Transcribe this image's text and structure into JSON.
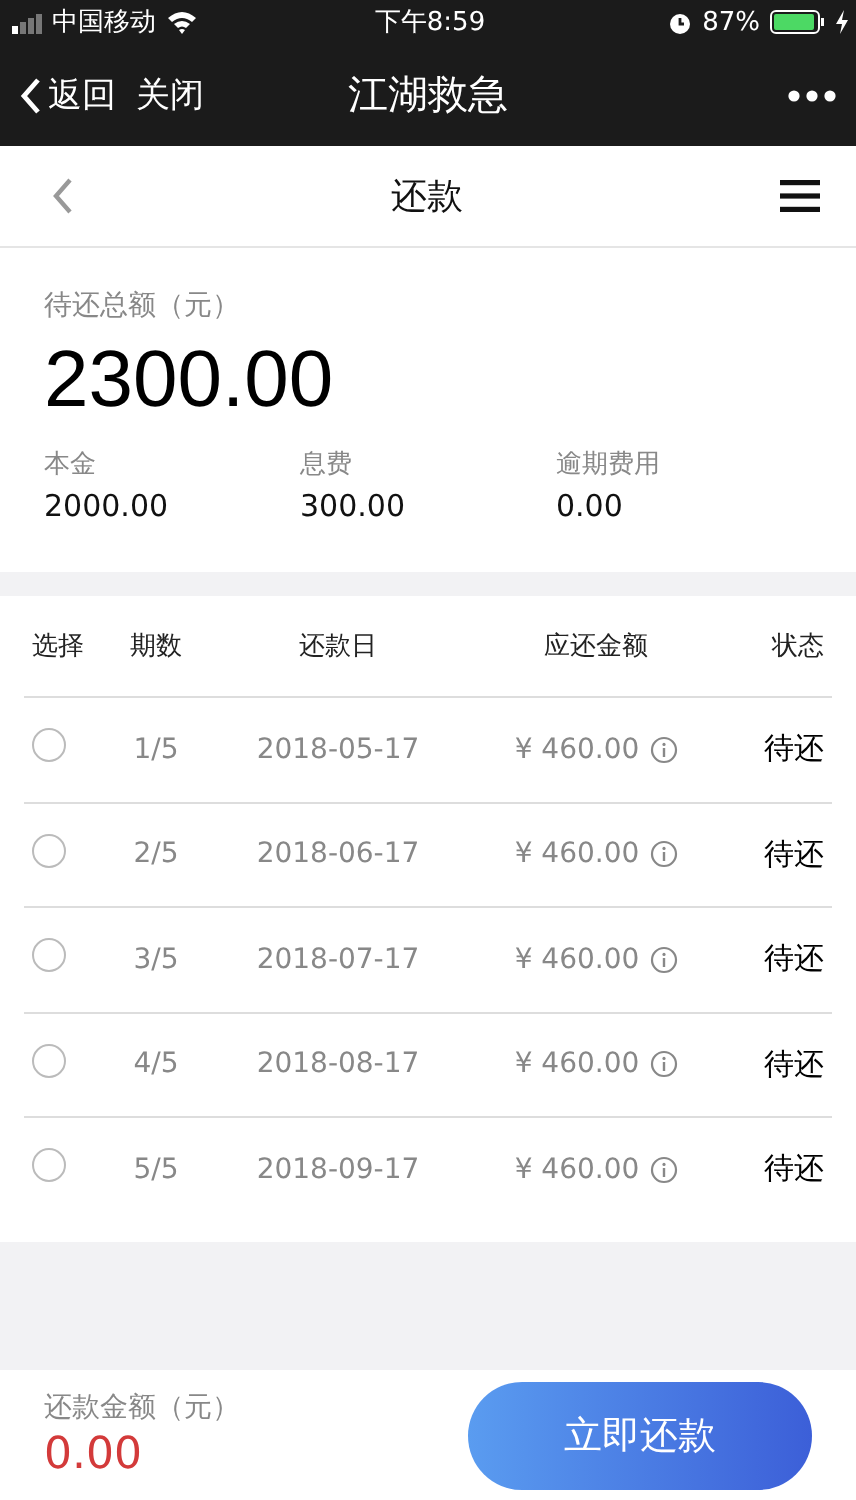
{
  "status_bar": {
    "carrier": "中国移动",
    "time": "下午8:59",
    "battery": "87%"
  },
  "nav_bar": {
    "back": "返回",
    "close": "关闭",
    "title": "江湖救急"
  },
  "page_header": {
    "title": "还款"
  },
  "summary": {
    "label": "待还总额（元）",
    "total": "2300.00",
    "items": [
      {
        "label": "本金",
        "value": "2000.00"
      },
      {
        "label": "息费",
        "value": "300.00"
      },
      {
        "label": "逾期费用",
        "value": "0.00"
      }
    ]
  },
  "table": {
    "columns": [
      "选择",
      "期数",
      "还款日",
      "应还金额",
      "状态"
    ],
    "rows": [
      {
        "selected": false,
        "period": "1/5",
        "date": "2018-05-17",
        "amount": "¥ 460.00",
        "status": "待还"
      },
      {
        "selected": false,
        "period": "2/5",
        "date": "2018-06-17",
        "amount": "¥ 460.00",
        "status": "待还"
      },
      {
        "selected": false,
        "period": "3/5",
        "date": "2018-07-17",
        "amount": "¥ 460.00",
        "status": "待还"
      },
      {
        "selected": false,
        "period": "4/5",
        "date": "2018-08-17",
        "amount": "¥ 460.00",
        "status": "待还"
      },
      {
        "selected": false,
        "period": "5/5",
        "date": "2018-09-17",
        "amount": "¥ 460.00",
        "status": "待还"
      }
    ]
  },
  "footer": {
    "label": "还款金额（元）",
    "amount": "0.00",
    "button": "立即还款"
  }
}
